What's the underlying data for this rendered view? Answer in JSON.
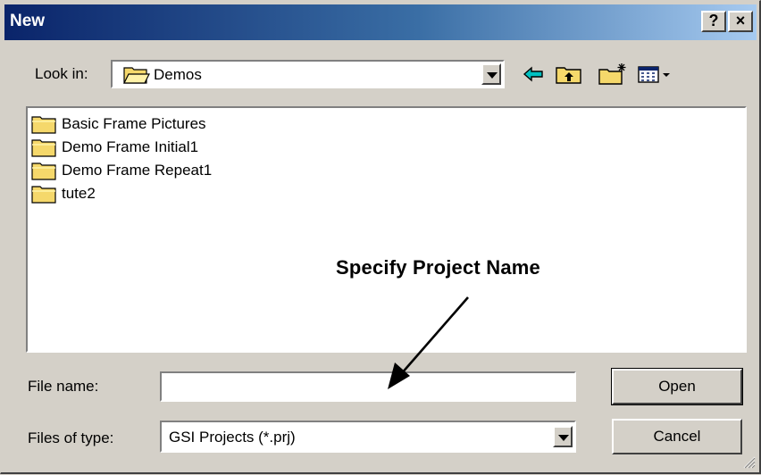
{
  "window": {
    "title": "New",
    "help_label": "?",
    "close_label": "×"
  },
  "look_in": {
    "label": "Look in:",
    "value": "Demos"
  },
  "toolbar": {
    "icons": [
      "back-arrow-icon",
      "up-folder-icon",
      "new-folder-icon",
      "view-menu-icon"
    ]
  },
  "files": [
    {
      "name": "Basic Frame Pictures",
      "icon": "folder-icon"
    },
    {
      "name": "Demo Frame Initial1",
      "icon": "folder-icon"
    },
    {
      "name": "Demo Frame Repeat1",
      "icon": "folder-icon"
    },
    {
      "name": "tute2",
      "icon": "folder-icon"
    }
  ],
  "annotation": "Specify Project Name",
  "file_name": {
    "label": "File name:",
    "value": ""
  },
  "file_type": {
    "label": "Files of type:",
    "value": "GSI Projects (*.prj)"
  },
  "buttons": {
    "open": "Open",
    "cancel": "Cancel"
  },
  "colors": {
    "title_gradient_start": "#0a246a",
    "title_gradient_end": "#a6caf0",
    "face": "#d4d0c8",
    "folder": "#f5d86b"
  }
}
